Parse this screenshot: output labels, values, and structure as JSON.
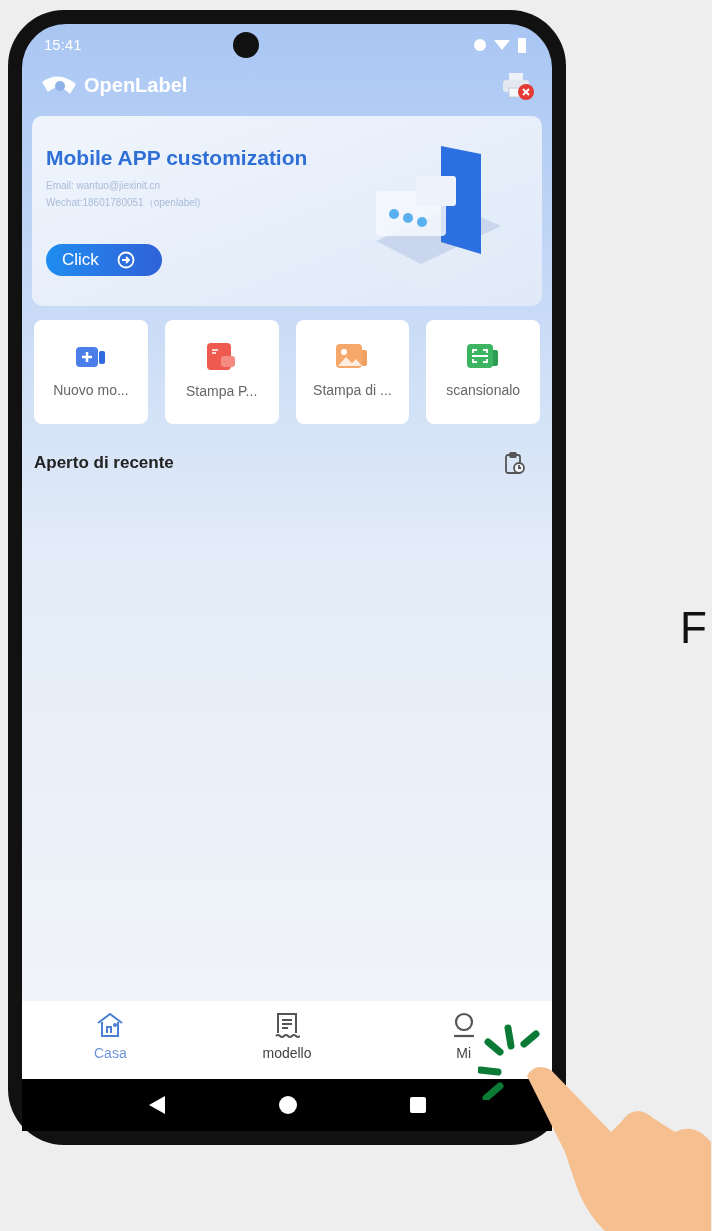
{
  "status_bar": {
    "time": "15:41"
  },
  "app_bar": {
    "title": "OpenLabel",
    "printer_connected": false
  },
  "banner": {
    "title": "Mobile APP customization",
    "email": "Email: wantuo@jiexinit.cn",
    "wechat": "Wechat:18601780051（openlabel)",
    "button": "Click"
  },
  "shortcuts": [
    {
      "kind": "new",
      "label": "Nuovo mo..."
    },
    {
      "kind": "pdf",
      "label": "Stampa P..."
    },
    {
      "kind": "image",
      "label": "Stampa di ..."
    },
    {
      "kind": "scan",
      "label": "scansionalo"
    }
  ],
  "recent": {
    "title": "Aperto di recente"
  },
  "bottom_nav": [
    {
      "kind": "home",
      "label": "Casa",
      "selected": true
    },
    {
      "kind": "template",
      "label": "modello",
      "selected": false
    },
    {
      "kind": "profile",
      "label": "Mi",
      "selected": false
    }
  ],
  "side_text": "F"
}
